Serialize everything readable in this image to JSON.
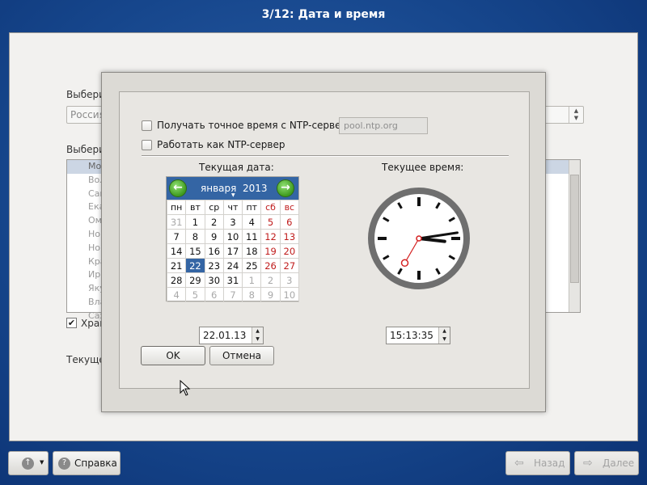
{
  "window_title": "3/12: Дата и время",
  "background": {
    "region_label": "Выбери",
    "region_value": "Россия",
    "city_label": "Выбери",
    "city_rows": [
      "Мо",
      "Вол",
      "Сам",
      "Ека",
      "Ом",
      "Нов",
      "Нов",
      "Кра",
      "Ир",
      "Яку",
      "Вла",
      "Сах"
    ],
    "store_label": "Хран",
    "current_label": "Текуще"
  },
  "dialog": {
    "ntp_sync_label": "Получать точное время с NTP-сервера:",
    "ntp_server_value": "pool.ntp.org",
    "ntp_server_label": "Работать как NTP-сервер",
    "date_header": "Текущая дата:",
    "time_header": "Текущее время:",
    "calendar": {
      "month": "января",
      "year": "2013",
      "weekdays": [
        "пн",
        "вт",
        "ср",
        "чт",
        "пт",
        "сб",
        "вс"
      ],
      "weeks": [
        [
          "31",
          "1",
          "2",
          "3",
          "4",
          "5",
          "6"
        ],
        [
          "7",
          "8",
          "9",
          "10",
          "11",
          "12",
          "13"
        ],
        [
          "14",
          "15",
          "16",
          "17",
          "18",
          "19",
          "20"
        ],
        [
          "21",
          "22",
          "23",
          "24",
          "25",
          "26",
          "27"
        ],
        [
          "28",
          "29",
          "30",
          "31",
          "1",
          "2",
          "3"
        ],
        [
          "4",
          "5",
          "6",
          "7",
          "8",
          "9",
          "10"
        ]
      ],
      "selected_day": "22"
    },
    "date_value": "22.01.13",
    "time_value": "15:13:35",
    "clock": {
      "hours": 15,
      "minutes": 13,
      "seconds": 35
    },
    "ok_label": "OK",
    "cancel_label": "Отмена"
  },
  "footer": {
    "help_label": "Справка",
    "back_label": "Назад",
    "next_label": "Далее"
  },
  "colors": {
    "accent": "#3465a4",
    "weekend": "#c01c1c",
    "nav_green": "#3f9b1f",
    "second_hand": "#d42020"
  }
}
